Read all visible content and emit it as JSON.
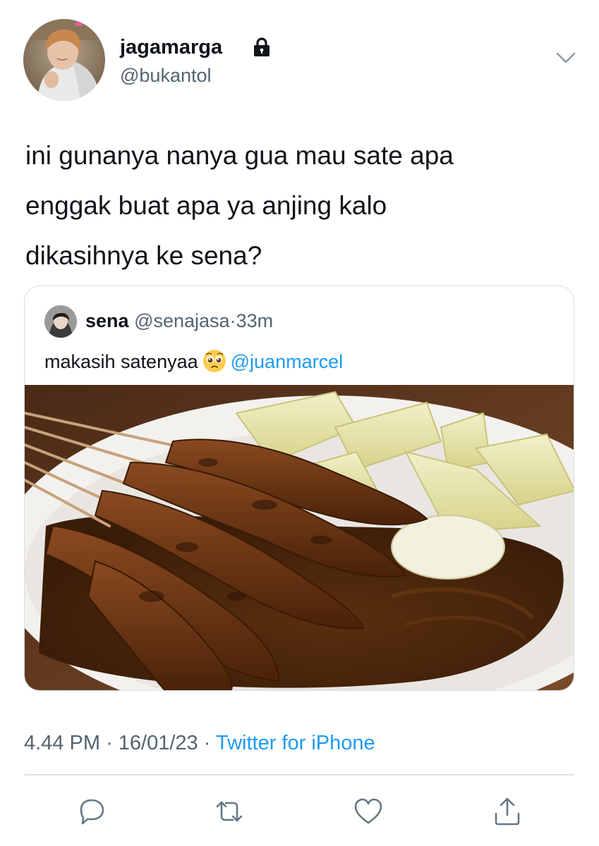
{
  "tweet": {
    "author": {
      "display_name": "jagamarga",
      "handle": "@bukantol",
      "protected_icon": "lock-icon"
    },
    "menu_icon": "chevron-down-icon",
    "text": "ini gunanya nanya gua mau sate apa\nenggak buat apa ya anjing kalo\ndikasihnya ke sena?",
    "quote": {
      "display_name": "sena",
      "handle": "@senajasa",
      "separator": "·",
      "time": "33m",
      "text": "makasih satenyaa",
      "emoji": "pleading-face-emoji",
      "mention": "@juanmarcel"
    },
    "time": "4.44 PM",
    "date": "16/01/23",
    "dot": "·",
    "client": "Twitter for iPhone",
    "actions": [
      "reply-icon",
      "retweet-icon",
      "like-icon",
      "share-icon"
    ]
  },
  "colors": {
    "text": "#0f1419",
    "secondary": "#536471",
    "link": "#1d9bf0",
    "border": "#d7dde2"
  }
}
